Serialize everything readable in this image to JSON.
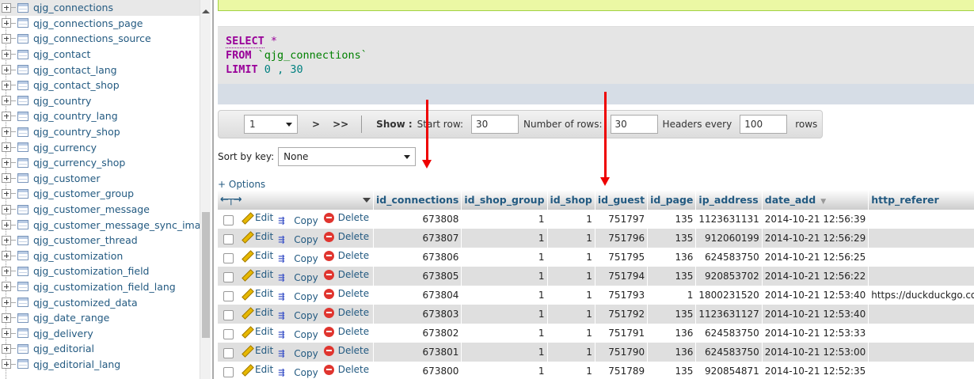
{
  "sidebar": {
    "tables": [
      "qjg_connections",
      "qjg_connections_page",
      "qjg_connections_source",
      "qjg_contact",
      "qjg_contact_lang",
      "qjg_contact_shop",
      "qjg_country",
      "qjg_country_lang",
      "qjg_country_shop",
      "qjg_currency",
      "qjg_currency_shop",
      "qjg_customer",
      "qjg_customer_group",
      "qjg_customer_message",
      "qjg_customer_message_sync_imap",
      "qjg_customer_thread",
      "qjg_customization",
      "qjg_customization_field",
      "qjg_customization_field_lang",
      "qjg_customized_data",
      "qjg_date_range",
      "qjg_delivery",
      "qjg_editorial",
      "qjg_editorial_lang"
    ],
    "selected": "qjg_connections"
  },
  "sql": {
    "select": "SELECT",
    "star": "*",
    "from": "FROM",
    "table": "`qjg_connections`",
    "limit": "LIMIT",
    "offset": "0",
    "comma": ",",
    "count": "30"
  },
  "navigation": {
    "page_value": "1",
    "next": ">",
    "last": ">>",
    "show_label": "Show :",
    "start_row_label": "Start row:",
    "start_row_value": "30",
    "num_rows_label": "Number of rows:",
    "num_rows_value": "30",
    "headers_every_label": "Headers every",
    "headers_every_value": "100",
    "rows_label": "rows"
  },
  "sort": {
    "label": "Sort by key:",
    "value": "None"
  },
  "options_link": "+ Options",
  "table": {
    "columns": [
      "id_connections",
      "id_shop_group",
      "id_shop",
      "id_guest",
      "id_page",
      "ip_address",
      "date_add",
      "http_referer"
    ],
    "actions": {
      "edit": "Edit",
      "copy": "Copy",
      "delete": "Delete"
    },
    "rows": [
      {
        "id_connections": "673808",
        "id_shop_group": "1",
        "id_shop": "1",
        "id_guest": "751797",
        "id_page": "135",
        "ip_address": "1123631131",
        "date_add": "2014-10-21 12:56:39",
        "http_referer": ""
      },
      {
        "id_connections": "673807",
        "id_shop_group": "1",
        "id_shop": "1",
        "id_guest": "751796",
        "id_page": "135",
        "ip_address": "912060199",
        "date_add": "2014-10-21 12:56:29",
        "http_referer": ""
      },
      {
        "id_connections": "673806",
        "id_shop_group": "1",
        "id_shop": "1",
        "id_guest": "751795",
        "id_page": "136",
        "ip_address": "624583750",
        "date_add": "2014-10-21 12:56:25",
        "http_referer": ""
      },
      {
        "id_connections": "673805",
        "id_shop_group": "1",
        "id_shop": "1",
        "id_guest": "751794",
        "id_page": "135",
        "ip_address": "920853702",
        "date_add": "2014-10-21 12:56:22",
        "http_referer": ""
      },
      {
        "id_connections": "673804",
        "id_shop_group": "1",
        "id_shop": "1",
        "id_guest": "751793",
        "id_page": "1",
        "ip_address": "1800231520",
        "date_add": "2014-10-21 12:53:40",
        "http_referer": "https://duckduckgo.com/"
      },
      {
        "id_connections": "673803",
        "id_shop_group": "1",
        "id_shop": "1",
        "id_guest": "751792",
        "id_page": "135",
        "ip_address": "1123631127",
        "date_add": "2014-10-21 12:53:40",
        "http_referer": ""
      },
      {
        "id_connections": "673802",
        "id_shop_group": "1",
        "id_shop": "1",
        "id_guest": "751791",
        "id_page": "136",
        "ip_address": "624583750",
        "date_add": "2014-10-21 12:53:33",
        "http_referer": ""
      },
      {
        "id_connections": "673801",
        "id_shop_group": "1",
        "id_shop": "1",
        "id_guest": "751790",
        "id_page": "136",
        "ip_address": "624583750",
        "date_add": "2014-10-21 12:53:00",
        "http_referer": ""
      },
      {
        "id_connections": "673800",
        "id_shop_group": "1",
        "id_shop": "1",
        "id_guest": "751789",
        "id_page": "135",
        "ip_address": "920854871",
        "date_add": "2014-10-21 12:52:35",
        "http_referer": ""
      }
    ]
  },
  "colors": {
    "link": "#235a81",
    "sql_keyword": "#990099",
    "annotation_arrow": "#ee0000"
  }
}
